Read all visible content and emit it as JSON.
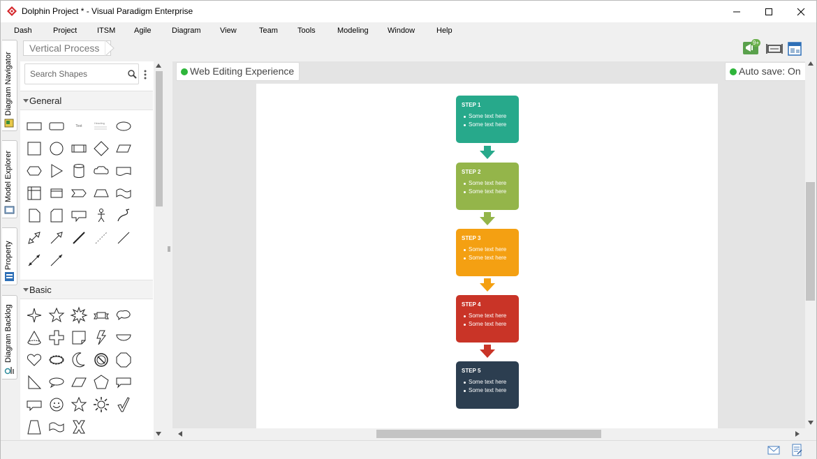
{
  "window": {
    "title": "Dolphin Project * - Visual Paradigm Enterprise",
    "controls": [
      "minimize",
      "maximize",
      "close"
    ]
  },
  "menu": [
    "Dash",
    "Project",
    "ITSM",
    "Agile",
    "Diagram",
    "View",
    "Team",
    "Tools",
    "Modeling",
    "Window",
    "Help"
  ],
  "left_tabs": [
    "Diagram Navigator",
    "Model Explorer",
    "Property",
    "Diagram Backlog"
  ],
  "breadcrumb": "Vertical Process",
  "notification_badge": "9+",
  "palette": {
    "search_placeholder": "Search Shapes",
    "sections": [
      {
        "label": "General"
      },
      {
        "label": "Basic"
      }
    ],
    "mini_text": {
      "text": "Text",
      "heading": "Heading"
    }
  },
  "status": {
    "web_editing": "Web Editing Experience",
    "auto_save": "Auto save: On",
    "dot_color": "#2fb53b"
  },
  "diagram": {
    "steps": [
      {
        "title": "STEP 1",
        "bullets": [
          "Some text here",
          "Some text here"
        ],
        "color": "#27a98b"
      },
      {
        "title": "STEP 2",
        "bullets": [
          "Some text here",
          "Some text here"
        ],
        "color": "#94b54a"
      },
      {
        "title": "STEP 3",
        "bullets": [
          "Some text here",
          "Some text here"
        ],
        "color": "#f4a012"
      },
      {
        "title": "STEP 4",
        "bullets": [
          "Some text here",
          "Some text here"
        ],
        "color": "#c93427"
      },
      {
        "title": "STEP 5",
        "bullets": [
          "Some text here",
          "Some text here"
        ],
        "color": "#2c3e50"
      }
    ]
  }
}
